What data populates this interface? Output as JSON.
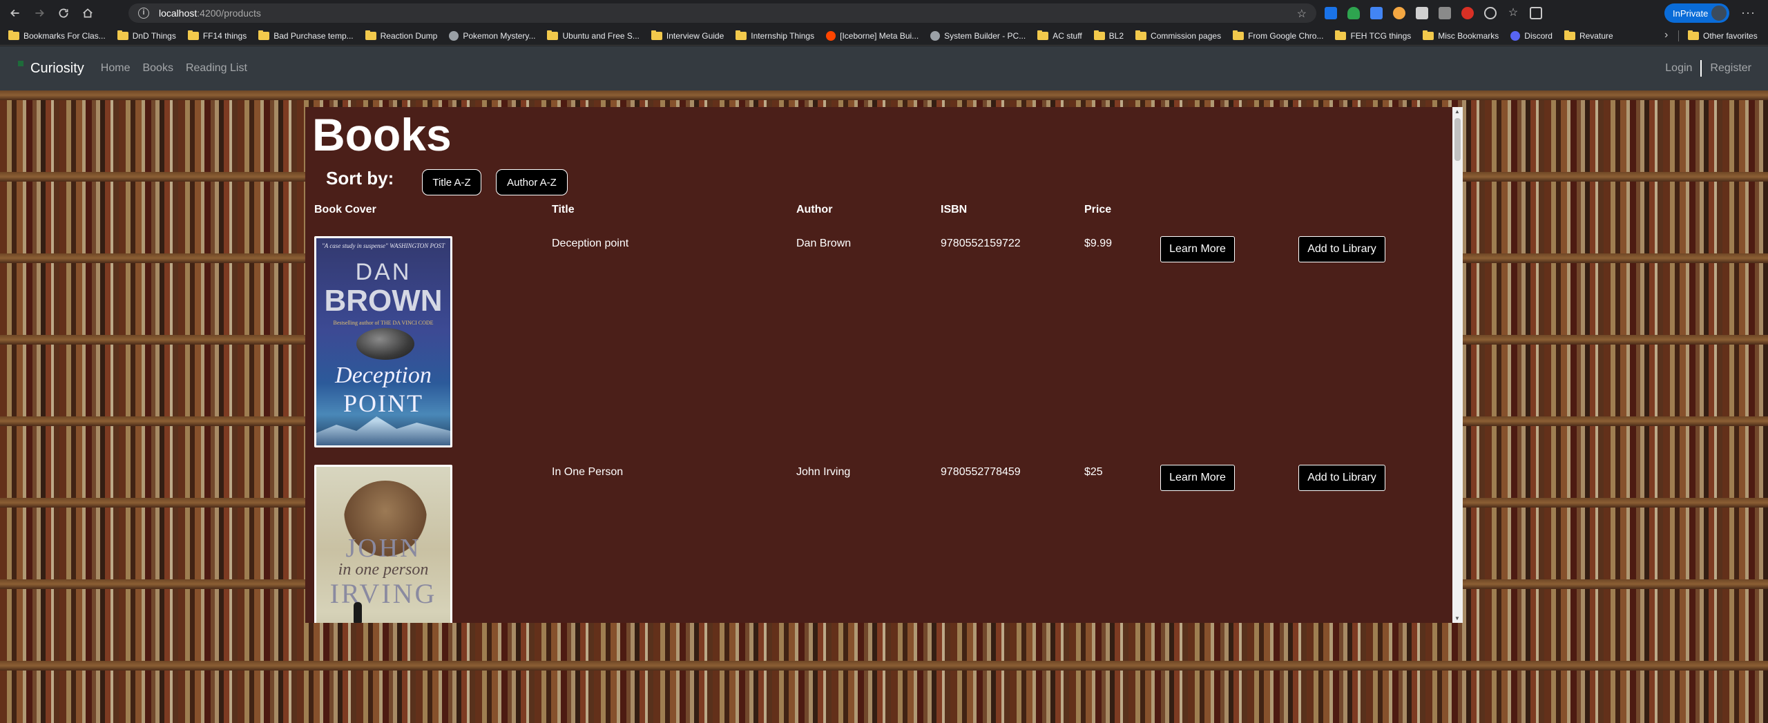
{
  "browser": {
    "url_host": "localhost",
    "url_path": ":4200/products",
    "inprivate_label": "InPrivate",
    "bookmarks": [
      {
        "label": "Bookmarks For Clas...",
        "icon": "folder-icon"
      },
      {
        "label": "DnD Things",
        "icon": "folder-icon"
      },
      {
        "label": "FF14 things",
        "icon": "folder-icon"
      },
      {
        "label": "Bad Purchase temp...",
        "icon": "folder-icon"
      },
      {
        "label": "Reaction Dump",
        "icon": "folder-icon"
      },
      {
        "label": "Pokemon Mystery...",
        "icon": "site-icon"
      },
      {
        "label": "Ubuntu and Free S...",
        "icon": "folder-icon"
      },
      {
        "label": "Interview Guide",
        "icon": "folder-icon"
      },
      {
        "label": "Internship Things",
        "icon": "folder-icon"
      },
      {
        "label": "[Iceborne] Meta Bui...",
        "icon": "reddit-icon"
      },
      {
        "label": "System Builder - PC...",
        "icon": "site-icon"
      },
      {
        "label": "AC stuff",
        "icon": "folder-icon"
      },
      {
        "label": "BL2",
        "icon": "folder-icon"
      },
      {
        "label": "Commission pages",
        "icon": "folder-icon"
      },
      {
        "label": "From Google Chro...",
        "icon": "folder-icon"
      },
      {
        "label": "FEH TCG things",
        "icon": "folder-icon"
      },
      {
        "label": "Misc Bookmarks",
        "icon": "folder-icon"
      },
      {
        "label": "Discord",
        "icon": "discord-icon"
      },
      {
        "label": "Revature",
        "icon": "folder-icon"
      }
    ],
    "other_favorites": "Other favorites"
  },
  "navbar": {
    "brand": "Curiosity",
    "links": [
      "Home",
      "Books",
      "Reading List"
    ],
    "login": "Login",
    "register": "Register"
  },
  "page": {
    "title": "Books",
    "sort_label": "Sort by:",
    "sort_buttons": [
      "Title A-Z",
      "Author A-Z"
    ],
    "columns": [
      "Book Cover",
      "Title",
      "Author",
      "ISBN",
      "Price"
    ],
    "learn_more": "Learn More",
    "add_to_library": "Add to Library"
  },
  "books": [
    {
      "title": "Deception point",
      "author": "Dan Brown",
      "isbn": "9780552159722",
      "price": "$9.99",
      "cover": {
        "quote": "\"A case study in suspense\" WASHINGTON POST",
        "line1": "DAN",
        "line2": "BROWN",
        "tag": "Bestselling author of THE DA VINCI CODE",
        "title1": "Deception",
        "title2": "POINT"
      }
    },
    {
      "title": "In One Person",
      "author": "John Irving",
      "isbn": "9780552778459",
      "price": "$25",
      "cover": {
        "line1": "JOHN",
        "line2": "in one person",
        "line3": "IRVING"
      }
    }
  ],
  "colors": {
    "navbar": "#343a40",
    "panel": "#4b1f19",
    "button_bg": "#000000",
    "inprivate": "#0a6cd8"
  }
}
